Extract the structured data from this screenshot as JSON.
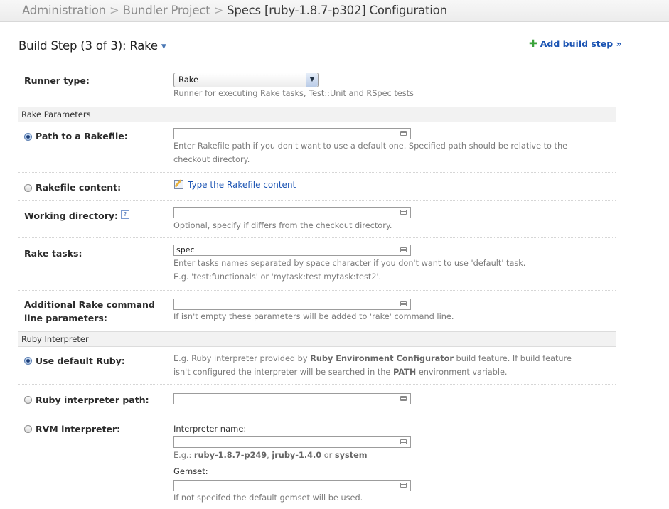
{
  "breadcrumb": {
    "items": [
      "Administration",
      "Bundler Project"
    ],
    "separator": ">",
    "current": "Specs [ruby-1.8.7-p302] Configuration"
  },
  "header": {
    "title": "Build Step (3 of 3): Rake",
    "add_step": "Add build step »"
  },
  "runner": {
    "label": "Runner type:",
    "selected": "Rake",
    "hint": "Runner for executing Rake tasks, Test::Unit and RSpec tests"
  },
  "rake_section": {
    "title": "Rake Parameters",
    "path": {
      "label": "Path to a Rakefile:",
      "value": "",
      "hint": "Enter Rakefile path if you don't want to use a default one. Specified path should be relative to the checkout directory."
    },
    "content": {
      "label": "Rakefile content:",
      "link": "Type the Rakefile content"
    },
    "workdir": {
      "label": "Working directory:",
      "help": "?",
      "value": "",
      "hint": "Optional, specify if differs from the checkout directory."
    },
    "tasks": {
      "label": "Rake tasks:",
      "value": "spec",
      "hint1": "Enter tasks names separated by space character if you don't want to use 'default' task.",
      "hint2": "E.g. 'test:functionals' or 'mytask:test mytask:test2'."
    },
    "additional": {
      "label1": "Additional Rake command",
      "label2": "line parameters:",
      "value": "",
      "hint": "If isn't empty these parameters will be added to 'rake' command line."
    }
  },
  "ruby_section": {
    "title": "Ruby Interpreter",
    "default_ruby": {
      "label": "Use default Ruby:",
      "hint_a": "E.g. Ruby interpreter provided by ",
      "hint_b": "Ruby Environment Configurator",
      "hint_c": " build feature. If build feature isn't configured the interpreter will be searched in the ",
      "hint_d": "PATH",
      "hint_e": " environment variable."
    },
    "interp_path": {
      "label": "Ruby interpreter path:",
      "value": ""
    },
    "rvm": {
      "label": "RVM interpreter:",
      "name_label": "Interpreter name:",
      "name_value": "",
      "name_hint_a": "E.g.: ",
      "name_hint_b": "ruby-1.8.7-p249",
      "name_hint_c": ", ",
      "name_hint_d": "jruby-1.4.0",
      "name_hint_e": " or ",
      "name_hint_f": "system",
      "gemset_label": "Gemset:",
      "gemset_value": "",
      "gemset_hint": "If not specifed the default gemset will be used."
    }
  }
}
